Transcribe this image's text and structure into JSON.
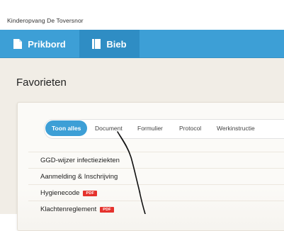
{
  "app": {
    "title": "Kinderopvang De Toversnor"
  },
  "nav": {
    "items": [
      {
        "label": "Prikbord",
        "icon": "bulletin-icon",
        "active": false
      },
      {
        "label": "Bieb",
        "icon": "book-icon",
        "active": true
      }
    ]
  },
  "page": {
    "title": "Favorieten"
  },
  "filters": {
    "items": [
      {
        "label": "Toon alles",
        "active": true
      },
      {
        "label": "Document",
        "active": false
      },
      {
        "label": "Formulier",
        "active": false
      },
      {
        "label": "Protocol",
        "active": false
      },
      {
        "label": "Werkinstructie",
        "active": false
      }
    ]
  },
  "documents": [
    {
      "title": "GGD-wijzer infectieziekten",
      "badge": ""
    },
    {
      "title": "Aanmelding & Inschrijving",
      "badge": ""
    },
    {
      "title": "Hygienecode",
      "badge": "PDF"
    },
    {
      "title": "Klachtenreglement",
      "badge": "PDF"
    }
  ],
  "colors": {
    "accent": "#3d9fd6",
    "accent_active": "#2f8dc4",
    "page_background": "#f1ede6",
    "pdf_badge": "#e5322d"
  }
}
